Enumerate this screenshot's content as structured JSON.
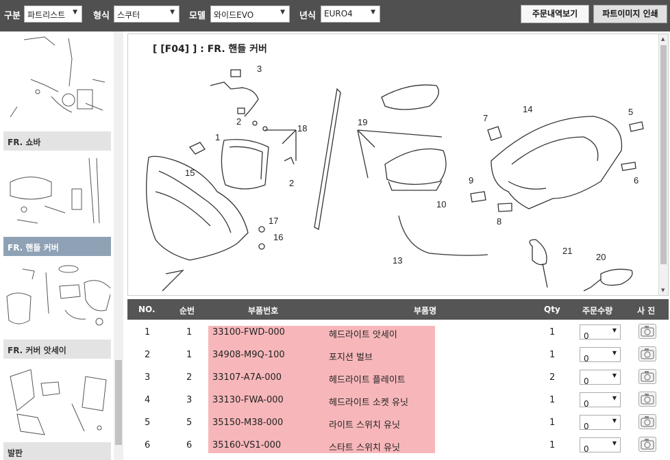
{
  "filters": {
    "gubun_label": "구분",
    "gubun_value": "파트리스트",
    "type_label": "형식",
    "type_value": "스쿠터",
    "model_label": "모델",
    "model_value": "와이드EVO",
    "year_label": "년식",
    "year_value": "EURO4"
  },
  "buttons": {
    "order_history": "주문내역보기",
    "print_image": "파트이미지 인쇄"
  },
  "sidebar": {
    "categories": [
      {
        "label": "FR. 쇼바"
      },
      {
        "label": "FR. 핸들 커버"
      },
      {
        "label": "FR. 커버 앗세이"
      },
      {
        "label": "발판"
      }
    ]
  },
  "diagram": {
    "title": "[ [F04] ] : FR. 핸들 커버",
    "callouts": [
      "1",
      "2",
      "3",
      "5",
      "6",
      "7",
      "8",
      "9",
      "10",
      "13",
      "14",
      "15",
      "16",
      "17",
      "18",
      "19",
      "20",
      "21"
    ]
  },
  "table": {
    "headers": [
      "NO.",
      "순번",
      "부품번호",
      "부품명",
      "Qty",
      "주문수량",
      "사 진"
    ],
    "rows": [
      {
        "no": "1",
        "seq": "1",
        "part_no": "33100-FWD-000",
        "name": "헤드라이트 앗세이",
        "qty": "1",
        "order_qty": "0"
      },
      {
        "no": "2",
        "seq": "1",
        "part_no": "34908-M9Q-100",
        "name": "포지션 벌브",
        "qty": "1",
        "order_qty": "0"
      },
      {
        "no": "3",
        "seq": "2",
        "part_no": "33107-A7A-000",
        "name": "헤드라이트 플레이트",
        "qty": "2",
        "order_qty": "0"
      },
      {
        "no": "4",
        "seq": "3",
        "part_no": "33130-FWA-000",
        "name": "헤드라이트 소켓 유닛",
        "qty": "1",
        "order_qty": "0"
      },
      {
        "no": "5",
        "seq": "5",
        "part_no": "35150-M38-000",
        "name": "라이트 스위치 유닛",
        "qty": "1",
        "order_qty": "0"
      },
      {
        "no": "6",
        "seq": "6",
        "part_no": "35160-VS1-000",
        "name": "스타트 스위치 유닛",
        "qty": "1",
        "order_qty": "0"
      }
    ]
  },
  "colors": {
    "topbar": "#505050",
    "highlight": "#f7b7ba",
    "active_category": "#8fa2b5"
  }
}
